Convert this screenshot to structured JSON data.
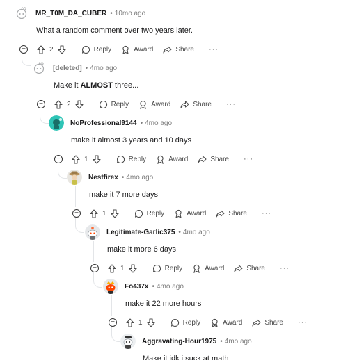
{
  "actions": {
    "reply": "Reply",
    "award": "Award",
    "share": "Share",
    "more": "···"
  },
  "separator": "•",
  "comments": [
    {
      "author": "MR_T0M_DA_CUBER",
      "time": "10mo ago",
      "text": "What a random comment over two years later.",
      "score": "2"
    },
    {
      "author": "[deleted]",
      "time": "4mo ago",
      "text_before": "Make it ",
      "text_bold": "ALMOST",
      "text_after": " three...",
      "score": "2"
    },
    {
      "author": "NoProfessional9144",
      "time": "4mo ago",
      "text": "make it almost 3 years and 10 days",
      "score": "1"
    },
    {
      "author": "Nestfirex",
      "time": "4mo ago",
      "text": "make it 7 more days",
      "score": "1"
    },
    {
      "author": "Legitimate-Garlic375",
      "time": "4mo ago",
      "text": "make it more 6 days",
      "score": "1"
    },
    {
      "author": "Fo437x",
      "time": "4mo ago",
      "text": "make it 22 more hours",
      "score": "1"
    },
    {
      "author": "Aggravating-Hour1975",
      "time": "4mo ago",
      "text": "Make it idk i suck at math"
    }
  ]
}
